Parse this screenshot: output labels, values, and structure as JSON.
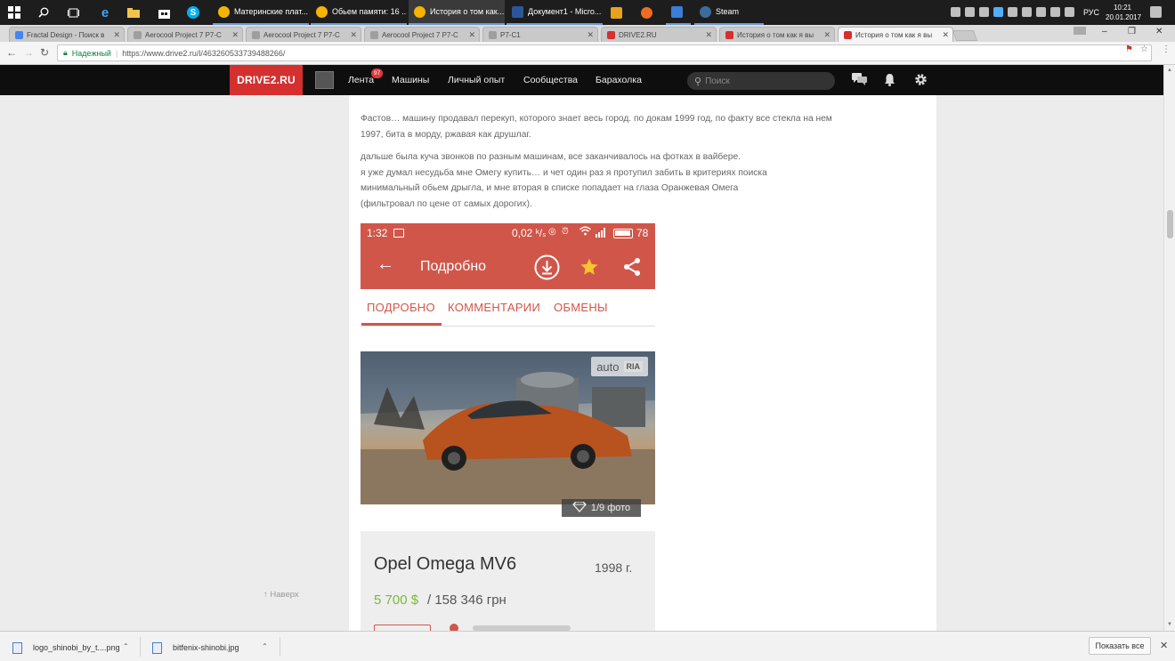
{
  "taskbar": {
    "tasks": [
      {
        "label": "Материнские плат...",
        "icon_color": "#f4b400"
      },
      {
        "label": "Обьем памяти: 16 ...",
        "icon_color": "#f4b400"
      },
      {
        "label": "История о том как...",
        "icon_color": "#f4b400"
      },
      {
        "label": "Документ1 - Micro...",
        "icon_color": "#2b579a"
      },
      {
        "label": "",
        "icon_color": "#e8a31b"
      },
      {
        "label": "",
        "icon_color": "#ef6b1f"
      },
      {
        "label": "",
        "icon_color": "#3b7dd8"
      },
      {
        "label": "Steam",
        "icon_color": "#1b2838"
      }
    ],
    "language": "РУС",
    "time": "10:21",
    "date": "20.01.2017"
  },
  "browser": {
    "tabs": [
      {
        "title": "Fractal Design - Поиск в",
        "favicon_color": "#4285f4"
      },
      {
        "title": "Aerocool Project 7 P7-C",
        "favicon_color": "#9e9e9e"
      },
      {
        "title": "Aerocool Project 7 P7-C",
        "favicon_color": "#9e9e9e"
      },
      {
        "title": "Aerocool Project 7 P7-C",
        "favicon_color": "#9e9e9e"
      },
      {
        "title": "P7-C1",
        "favicon_color": "#9e9e9e"
      },
      {
        "title": "DRIVE2.RU",
        "favicon_color": "#d3302f"
      },
      {
        "title": "История о том как я вы",
        "favicon_color": "#d3302f"
      },
      {
        "title": "История о том как я вы",
        "favicon_color": "#d3302f"
      }
    ],
    "secure_label": "Надежный",
    "url": "https://www.drive2.ru/l/463260533739488266/"
  },
  "site": {
    "logo": "DRIVE2.RU",
    "nav": [
      "Лента",
      "Машины",
      "Личный опыт",
      "Сообщества",
      "Барахолка"
    ],
    "lenta_badge": "97",
    "search_placeholder": "Поиск"
  },
  "article": {
    "paragraph1": "Фастов… машину продавал перекуп, которого знает весь город. по докам 1999 год, по факту все стекла на нем\n1997, бита в морду, ржавая как друшлаг.",
    "paragraph2": "дальше была куча звонков по разным машинам, все заканчивалось на фотках в вайбере.\nя уже думал несудьба мне Омегу купить… и чет один раз я протупил забить в критериях поиска\nминимальный обьем дрыгла, и мне вторая в списке попадает на глаза Оранжевая Омега\n(фильтровал по цене от самых дорогих).",
    "back_to_top": "Наверх"
  },
  "phone_screenshot": {
    "status_time": "1:32",
    "status_right": "0,02 ᵏ/ₛ",
    "battery": "78",
    "toolbar_title": "Подробно",
    "tabs": [
      "ПОДРОБНО",
      "КОММЕНТАРИИ",
      "ОБМЕНЫ"
    ],
    "watermark_auto": "auto",
    "watermark_ria": "RIA",
    "photo_counter": "1/9 фото",
    "car_title": "Opel Omega MV6",
    "car_year": "1998 г.",
    "price_usd": "5 700 $",
    "price_uah": "/ 158 346 грн",
    "accent_color": "#d1564a"
  },
  "downloads": {
    "items": [
      "logo_shinobi_by_t....png",
      "bitfenix-shinobi.jpg"
    ],
    "show_all": "Показать все"
  }
}
